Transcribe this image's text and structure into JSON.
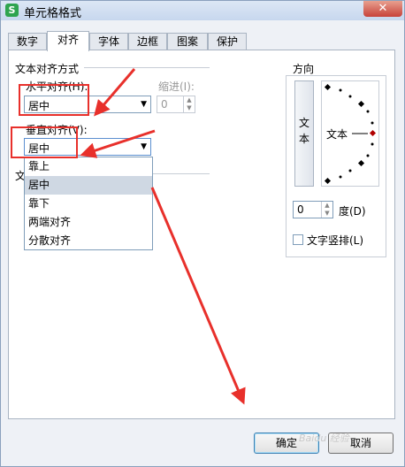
{
  "window": {
    "title": "单元格格式",
    "app_icon": "S",
    "close_symbol": "✕"
  },
  "tabs": [
    {
      "label": "数字",
      "active": false
    },
    {
      "label": "对齐",
      "active": true
    },
    {
      "label": "字体",
      "active": false
    },
    {
      "label": "边框",
      "active": false
    },
    {
      "label": "图案",
      "active": false
    },
    {
      "label": "保护",
      "active": false
    }
  ],
  "text_alignment": {
    "group_label": "文本对齐方式",
    "horizontal_label": "水平对齐(H):",
    "horizontal_value": "居中",
    "indent_label": "缩进(I):",
    "indent_value": "0",
    "vertical_label": "垂直对齐(V):",
    "vertical_value": "居中",
    "hidden_group_initial": "文",
    "dropdown_options": [
      "靠上",
      "居中",
      "靠下",
      "两端对齐",
      "分散对齐"
    ],
    "dropdown_selected_index": 1
  },
  "orientation": {
    "group_label": "方向",
    "vertical_text_chars": [
      "文",
      "本"
    ],
    "dial_text": "文本",
    "degree_value": "0",
    "degree_label": "度(D)",
    "vertical_checkbox_label": "文字竖排(L)"
  },
  "buttons": {
    "ok": "确定",
    "cancel": "取消"
  },
  "icons": {
    "dropdown_arrow": "▼",
    "spin_up": "▲",
    "spin_down": "▼"
  },
  "watermark": "Baidu 经验",
  "colors": {
    "annotation_red": "#e8302b",
    "title_bar": "#c7d7ee",
    "dial_marker": "#b00000"
  }
}
